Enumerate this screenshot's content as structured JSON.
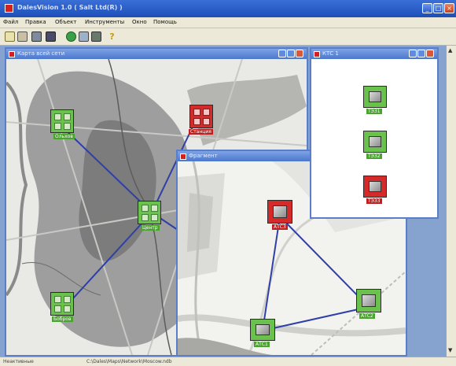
{
  "app": {
    "title": "DalesVision 1.0 ( Salt Ltd(R) )"
  },
  "menu": {
    "items": [
      "Файл",
      "Правка",
      "Объект",
      "Инструменты",
      "Окно",
      "Помощь"
    ]
  },
  "toolbar": {
    "buttons": [
      "new-icon",
      "open-icon",
      "find-icon",
      "document-icon",
      "refresh-icon",
      "settings-icon",
      "grid-icon",
      "help-icon"
    ]
  },
  "windows": {
    "map_main": {
      "title": "Карта всей сети"
    },
    "map_zoom": {
      "title": "Фрагмент"
    },
    "station": {
      "title": "КТС 1"
    }
  },
  "nodes": {
    "main": [
      {
        "label": "Ольхов",
        "status": "ok"
      },
      {
        "label": "Центр",
        "status": "ok"
      },
      {
        "label": "Станция",
        "status": "alarm"
      },
      {
        "label": "Бобров",
        "status": "ok"
      }
    ],
    "zoom": [
      {
        "label": "АТС3",
        "status": "alarm"
      },
      {
        "label": "АТС2",
        "status": "ok"
      },
      {
        "label": "АТС1",
        "status": "ok"
      }
    ],
    "station": [
      {
        "label": "ТЭЗ1",
        "status": "ok"
      },
      {
        "label": "ТЭЗ2",
        "status": "ok"
      },
      {
        "label": "ТЭЗ3",
        "status": "alarm"
      }
    ]
  },
  "colors": {
    "ok": "#6ac24c",
    "alarm": "#d42a2a",
    "link": "#2f3fa8"
  },
  "status": {
    "left": "Неактивные",
    "right": "C:\\Dales\\Maps\\Network\\Moscow.ndb"
  }
}
